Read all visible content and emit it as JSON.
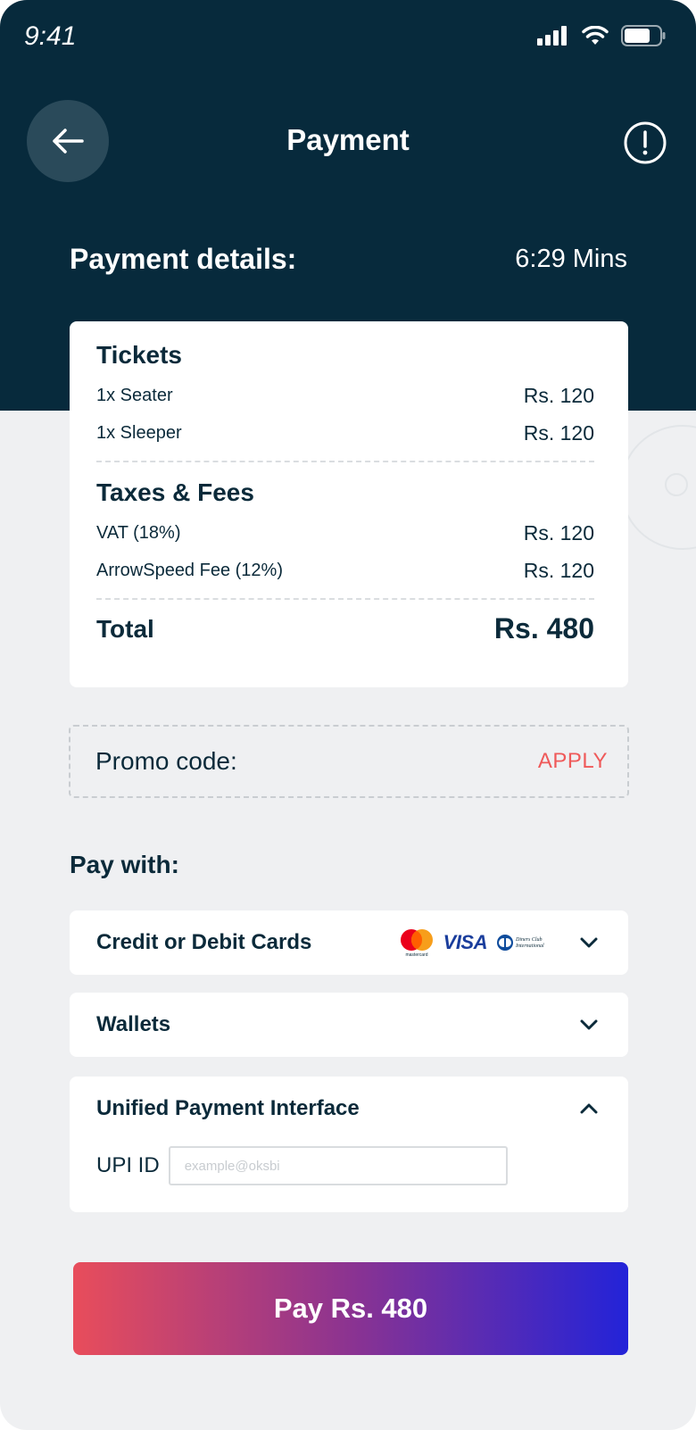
{
  "status_bar": {
    "time": "9:41"
  },
  "header": {
    "title": "Payment"
  },
  "details": {
    "title": "Payment details:",
    "timer": "6:29 Mins"
  },
  "summary": {
    "tickets": {
      "title": "Tickets",
      "items": [
        {
          "label": "1x Seater",
          "amount": "Rs. 120"
        },
        {
          "label": "1x Sleeper",
          "amount": "Rs. 120"
        }
      ]
    },
    "taxes": {
      "title": "Taxes & Fees",
      "items": [
        {
          "label": "VAT (18%)",
          "amount": "Rs. 120"
        },
        {
          "label": "ArrowSpeed Fee (12%)",
          "amount": "Rs. 120"
        }
      ]
    },
    "total": {
      "label": "Total",
      "amount": "Rs. 480"
    }
  },
  "promo": {
    "label": "Promo code:",
    "apply": "APPLY"
  },
  "pay_with": {
    "title": "Pay with:",
    "methods": [
      {
        "label": "Credit or Debit Cards",
        "expanded": false,
        "logos": [
          "mastercard-logo",
          "visa-logo",
          "diners-club-logo"
        ]
      },
      {
        "label": "Wallets",
        "expanded": false
      },
      {
        "label": "Unified Payment Interface",
        "expanded": true
      }
    ],
    "upi": {
      "label": "UPI ID",
      "placeholder": "example@oksbi",
      "value": ""
    }
  },
  "pay_button": {
    "label": "Pay Rs. 480"
  },
  "logos": {
    "mastercard": "mastercard",
    "visa": "VISA",
    "diners_line1": "Diners Club",
    "diners_line2": "International"
  },
  "colors": {
    "header_bg": "#072a3c",
    "page_bg": "#eff0f2",
    "text_dark": "#0b2a3a",
    "apply": "#ef5a5a",
    "gradient_start": "#e84d5b",
    "gradient_end": "#2323d8"
  }
}
